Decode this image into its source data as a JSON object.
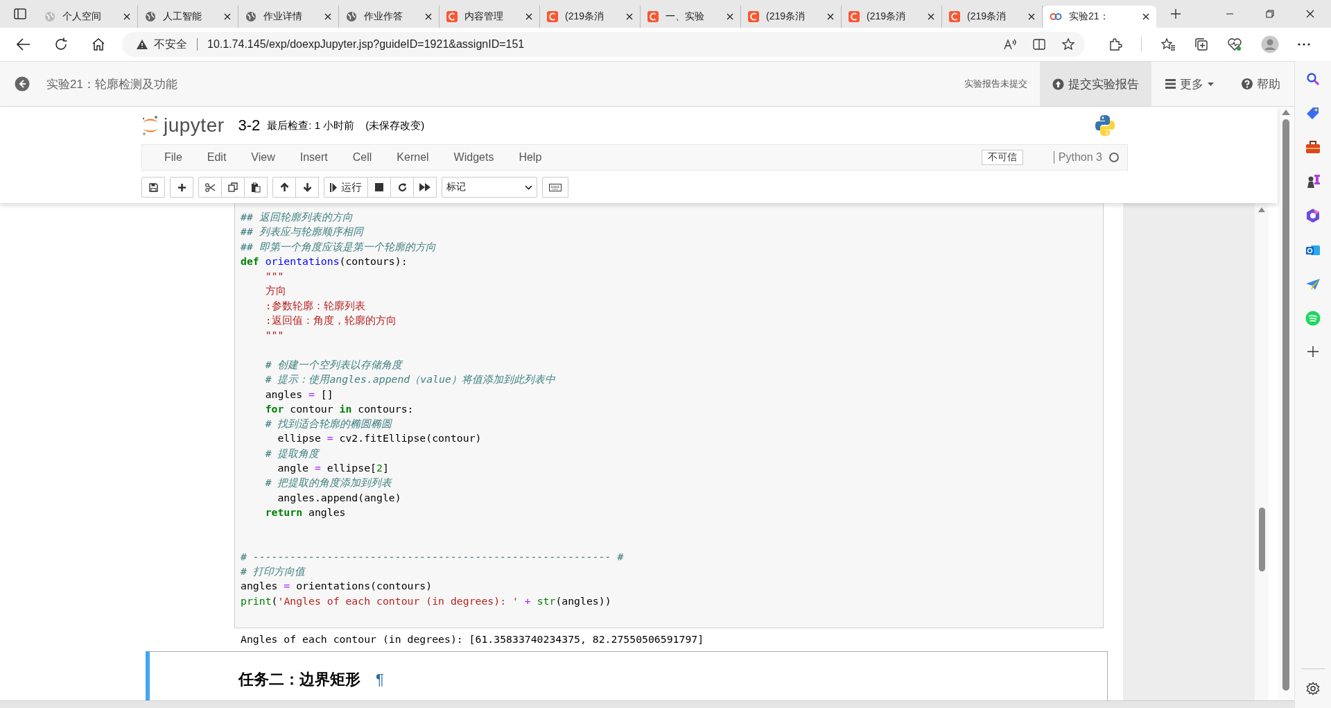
{
  "browser": {
    "tabs": [
      {
        "label": "个人空间",
        "kind": "globe",
        "selected": false
      },
      {
        "label": "人工智能",
        "kind": "globe",
        "selected": false
      },
      {
        "label": "作业详情",
        "kind": "globe",
        "selected": false
      },
      {
        "label": "作业作答",
        "kind": "globe",
        "selected": false
      },
      {
        "label": "内容管理",
        "kind": "c",
        "selected": false
      },
      {
        "label": "(219条消",
        "kind": "c",
        "selected": false
      },
      {
        "label": "一、实验",
        "kind": "c",
        "selected": false
      },
      {
        "label": "(219条消",
        "kind": "c",
        "selected": false
      },
      {
        "label": "(219条消",
        "kind": "c",
        "selected": false
      },
      {
        "label": "(219条消",
        "kind": "c",
        "selected": false
      },
      {
        "label": "实验21：",
        "kind": "cq",
        "selected": true
      }
    ],
    "security": "不安全",
    "url": "10.1.74.145/exp/doexpJupyter.jsp?guideID=1921&assignID=151"
  },
  "page_header": {
    "title": "实验21：轮廓检测及功能",
    "status": "实验报告未提交",
    "submit": "提交实验报告",
    "more": "更多",
    "help": "帮助"
  },
  "notebook": {
    "logo": "jupyter",
    "name": "3-2",
    "checkpoint": "最后检查: 1 小时前",
    "unsaved": "(未保存改变)",
    "menu": [
      "File",
      "Edit",
      "View",
      "Insert",
      "Cell",
      "Kernel",
      "Widgets",
      "Help"
    ],
    "trust": "不可信",
    "kernel": "Python 3",
    "kernel_busy": false,
    "toolbar": {
      "run": "运行",
      "cell_type": "标记"
    }
  },
  "code_cell": {
    "lines": [
      {
        "kind": "code",
        "tokens": [
          {
            "text": "## 返回轮廓列表的方向",
            "kind": "cm"
          }
        ]
      },
      {
        "kind": "code",
        "tokens": [
          {
            "text": "## 列表应与轮廓顺序相同",
            "kind": "cm"
          }
        ]
      },
      {
        "kind": "code",
        "tokens": [
          {
            "text": "## 即第一个角度应该是第一个轮廓的方向",
            "kind": "cm"
          }
        ]
      },
      {
        "kind": "code",
        "tokens": [
          {
            "text": "def ",
            "kind": "kw"
          },
          {
            "text": "orientations",
            "kind": "fn"
          },
          {
            "text": "(contours):",
            "kind": "plain"
          }
        ]
      },
      {
        "kind": "code",
        "tokens": [
          {
            "text": "    \"\"\"",
            "kind": "str"
          }
        ]
      },
      {
        "kind": "code",
        "tokens": [
          {
            "text": "    方向",
            "kind": "str"
          }
        ]
      },
      {
        "kind": "code",
        "tokens": [
          {
            "text": "    :参数轮廓：轮廓列表",
            "kind": "str"
          }
        ]
      },
      {
        "kind": "code",
        "tokens": [
          {
            "text": "    :返回值：角度，轮廓的方向",
            "kind": "str"
          }
        ]
      },
      {
        "kind": "code",
        "tokens": [
          {
            "text": "    \"\"\"",
            "kind": "str"
          }
        ]
      },
      {
        "kind": "blank"
      },
      {
        "kind": "code",
        "tokens": [
          {
            "text": "    # 创建一个空列表以存储角度",
            "kind": "cm"
          }
        ]
      },
      {
        "kind": "code",
        "tokens": [
          {
            "text": "    # 提示：使用angles.append（value）将值添加到此列表中",
            "kind": "cm"
          }
        ]
      },
      {
        "kind": "code",
        "tokens": [
          {
            "text": "    angles ",
            "kind": "plain"
          },
          {
            "text": "=",
            "kind": "op"
          },
          {
            "text": " []",
            "kind": "plain"
          }
        ]
      },
      {
        "kind": "code",
        "tokens": [
          {
            "text": "    for",
            "kind": "kw"
          },
          {
            "text": " contour ",
            "kind": "plain"
          },
          {
            "text": "in",
            "kind": "kw"
          },
          {
            "text": " contours:",
            "kind": "plain"
          }
        ]
      },
      {
        "kind": "code",
        "tokens": [
          {
            "text": "    # 找到适合轮廓的椭圆椭圆",
            "kind": "cm"
          }
        ]
      },
      {
        "kind": "code",
        "tokens": [
          {
            "text": "      ellipse ",
            "kind": "plain"
          },
          {
            "text": "=",
            "kind": "op"
          },
          {
            "text": " cv2.fitEllipse(contour)",
            "kind": "plain"
          }
        ]
      },
      {
        "kind": "code",
        "tokens": [
          {
            "text": "    # 提取角度",
            "kind": "cm"
          }
        ]
      },
      {
        "kind": "code",
        "tokens": [
          {
            "text": "      angle ",
            "kind": "plain"
          },
          {
            "text": "=",
            "kind": "op"
          },
          {
            "text": " ellipse[",
            "kind": "plain"
          },
          {
            "text": "2",
            "kind": "num"
          },
          {
            "text": "]",
            "kind": "plain"
          }
        ]
      },
      {
        "kind": "code",
        "tokens": [
          {
            "text": "    # 把提取的角度添加到列表",
            "kind": "cm"
          }
        ]
      },
      {
        "kind": "code",
        "tokens": [
          {
            "text": "      angles.append(angle)",
            "kind": "plain"
          }
        ]
      },
      {
        "kind": "code",
        "tokens": [
          {
            "text": "    return",
            "kind": "kw"
          },
          {
            "text": " angles",
            "kind": "plain"
          }
        ]
      },
      {
        "kind": "blank"
      },
      {
        "kind": "blank"
      },
      {
        "kind": "code",
        "tokens": [
          {
            "text": "# ---------------------------------------------------------- #",
            "kind": "cm"
          }
        ]
      },
      {
        "kind": "code",
        "tokens": [
          {
            "text": "# 打印方向值",
            "kind": "cm"
          }
        ]
      },
      {
        "kind": "code",
        "tokens": [
          {
            "text": "angles ",
            "kind": "plain"
          },
          {
            "text": "=",
            "kind": "op"
          },
          {
            "text": " orientations(contours)",
            "kind": "plain"
          }
        ]
      },
      {
        "kind": "code",
        "tokens": [
          {
            "text": "print",
            "kind": "builtin"
          },
          {
            "text": "(",
            "kind": "plain"
          },
          {
            "text": "'Angles of each contour (in degrees): '",
            "kind": "str"
          },
          {
            "text": " + ",
            "kind": "op"
          },
          {
            "text": "str",
            "kind": "builtin"
          },
          {
            "text": "(angles))",
            "kind": "plain"
          }
        ]
      }
    ],
    "output": "Angles of each contour (in degrees): [61.35833740234375, 82.27550506591797]"
  },
  "markdown_cell": {
    "heading": "任务二：边界矩形",
    "anchor": "¶"
  }
}
